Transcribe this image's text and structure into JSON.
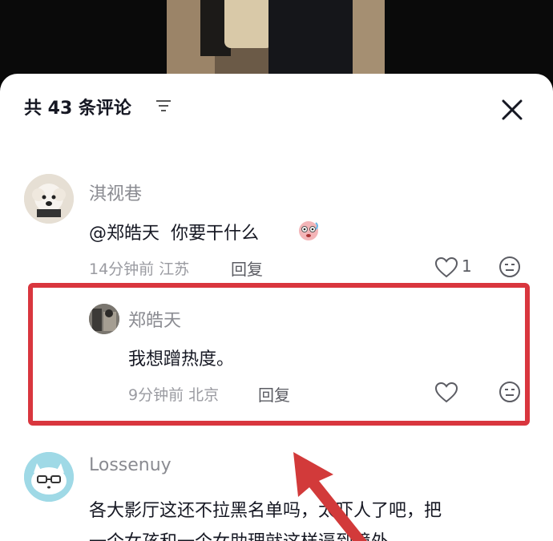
{
  "header": {
    "title": "共 43 条评论"
  },
  "comments": [
    {
      "username": "淇视巷",
      "mention": "@郑皓天",
      "text": "你要干什么",
      "time_location": "14分钟前 江苏",
      "reply_label": "回复",
      "like_count": "1"
    },
    {
      "username": "郑皓天",
      "text": "我想蹭热度。",
      "time_location": "9分钟前 北京",
      "reply_label": "回复"
    },
    {
      "username": "Lossenuy",
      "text_line1": "各大影厅这还不拉黑名单吗，太吓人了吧，把",
      "text_line2": "一个女孩和一个女助理就这样逼到境外"
    }
  ],
  "colors": {
    "highlight": "#d9363e",
    "arrow": "#d23a3a"
  }
}
